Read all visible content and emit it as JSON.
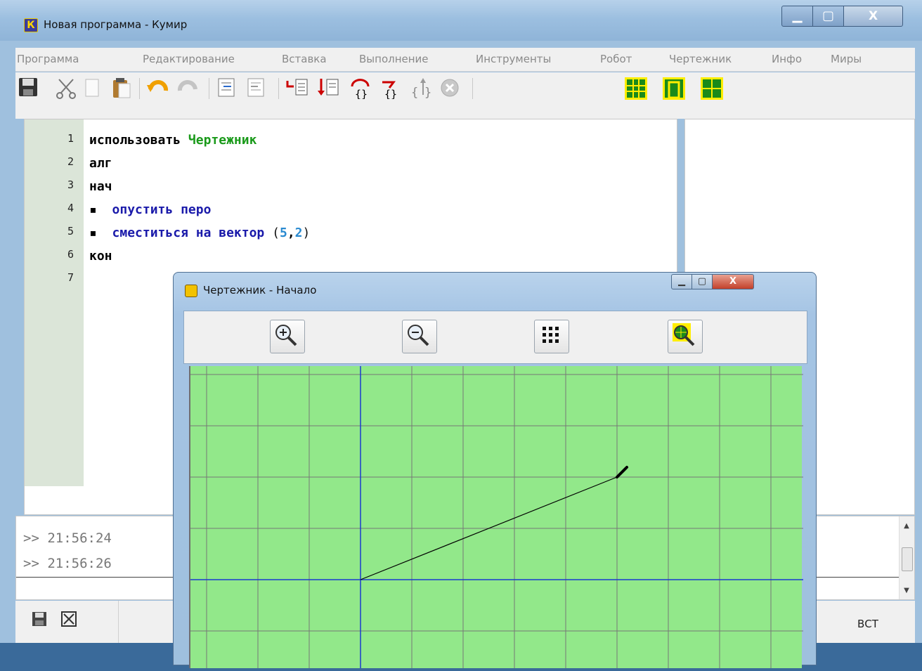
{
  "window": {
    "title": "Новая программа - Кумир",
    "app_icon_letter": "К",
    "controls": {
      "minimize": "▁",
      "maximize": "▢",
      "close": "X"
    }
  },
  "menu": [
    "Программа",
    "Редактирование",
    "Вставка",
    "Выполнение",
    "Инструменты",
    "Робот",
    "Чертежник",
    "Инфо",
    "Миры"
  ],
  "toolbar": {
    "icons": [
      "save-icon",
      "cut-icon",
      "copy-icon",
      "paste-icon",
      "undo-icon",
      "redo-icon",
      "indent-icon",
      "unindent-icon",
      "run-icon",
      "step-icon",
      "step-into-icon",
      "step-over-icon",
      "step-out-icon",
      "stop-icon",
      "robot-grid-icon",
      "drawer-frame-icon",
      "drawer-axes-icon"
    ]
  },
  "editor": {
    "line_numbers": [
      "1",
      "2",
      "3",
      "4",
      "5",
      "6",
      "7"
    ],
    "lines": [
      {
        "keyword": "использовать",
        "name": "Чертежник"
      },
      {
        "keyword": "алг"
      },
      {
        "keyword": "нач"
      },
      {
        "bullet": "▪",
        "command": "опустить перо"
      },
      {
        "bullet": "▪",
        "command": "сместиться на вектор",
        "open": "(",
        "arg1": "5",
        "comma": ",",
        "arg2": "2",
        "close": ")"
      },
      {
        "keyword": "кон"
      }
    ]
  },
  "console": {
    "lines": [
      ">> 21:56:24",
      ">> 21:56:26"
    ]
  },
  "statusbar": {
    "mode": "ВСТ"
  },
  "drawer_window": {
    "title": "Чертежник - Начало",
    "controls": {
      "minimize": "▁",
      "maximize": "▢",
      "close": "X"
    },
    "tools": [
      "zoom-in-icon",
      "zoom-out-icon",
      "grid-icon",
      "fit-view-icon"
    ],
    "drawing": {
      "grid_step": 1,
      "origin_visible": true,
      "pen_start": [
        0,
        0
      ],
      "pen_end": [
        5,
        2
      ],
      "axis_color": "#1a3ad0",
      "grid_color": "#777777",
      "background": "#92e88a"
    }
  }
}
